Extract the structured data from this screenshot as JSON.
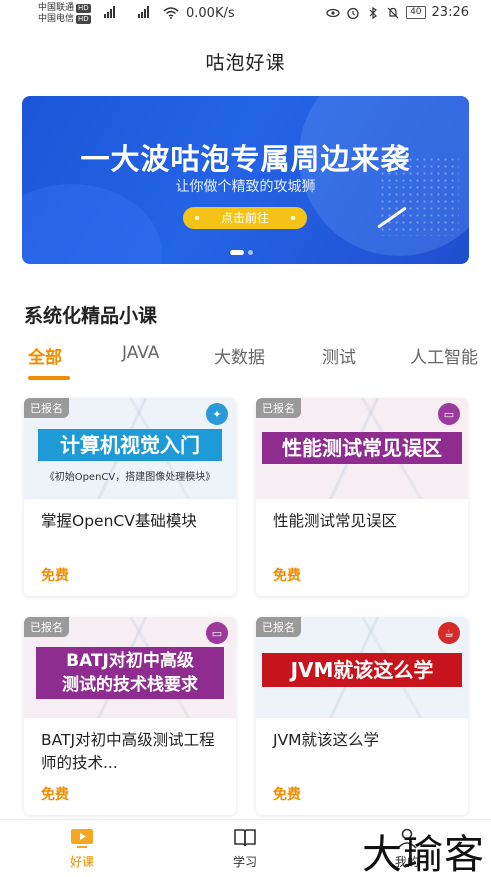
{
  "status_bar": {
    "carrier1": "中国联通",
    "carrier2": "中国电信",
    "hd": "HD",
    "net": "4G",
    "speed": "0.00K/s",
    "battery": "40",
    "time": "23:26"
  },
  "header": {
    "title": "咕泡好课"
  },
  "banner": {
    "headline": "一大波咕泡专属周边来袭",
    "subtitle": "让你做个精致的攻城狮",
    "cta": "点击前往",
    "dots_total": 2,
    "active_dot": 0
  },
  "section": {
    "title": "系统化精品小课"
  },
  "tabs": [
    {
      "label": "全部",
      "active": true
    },
    {
      "label": "JAVA",
      "active": false
    },
    {
      "label": "大数据",
      "active": false
    },
    {
      "label": "测试",
      "active": false
    },
    {
      "label": "人工智能",
      "active": false
    }
  ],
  "courses": [
    {
      "tag": "已报名",
      "thumb_title": "计算机视觉入门",
      "thumb_caption": "《初始OpenCV，搭建图像处理模块》",
      "title": "掌握OpenCV基础模块",
      "price": "免费",
      "thumb_color": "#1e9ad6",
      "icon": "brain-icon"
    },
    {
      "tag": "已报名",
      "thumb_title": "性能测试常见误区",
      "thumb_caption": "",
      "title": "性能测试常见误区",
      "price": "免费",
      "thumb_color": "#8e2d8f",
      "icon": "monitor-icon"
    },
    {
      "tag": "已报名",
      "thumb_title_line1": "BATJ对初中高级",
      "thumb_title_line2": "测试的技术栈要求",
      "title": "BATJ对初中高级测试工程师的技术...",
      "price": "免费",
      "thumb_color": "#8e2d8f",
      "icon": "monitor-icon"
    },
    {
      "tag": "已报名",
      "thumb_title": "JVM就该这么学",
      "title": "JVM就该这么学",
      "price": "免费",
      "thumb_color": "#c8151d",
      "icon": "java-icon"
    }
  ],
  "bottom_nav": [
    {
      "label": "好课",
      "icon": "play-icon",
      "active": true
    },
    {
      "label": "学习",
      "icon": "book-icon",
      "active": false
    },
    {
      "label": "我的",
      "icon": "person-icon",
      "active": false
    }
  ],
  "watermark": "大瑜客",
  "colors": {
    "accent": "#f08c00",
    "banner": "#2563e6",
    "cta": "#f5c318"
  }
}
